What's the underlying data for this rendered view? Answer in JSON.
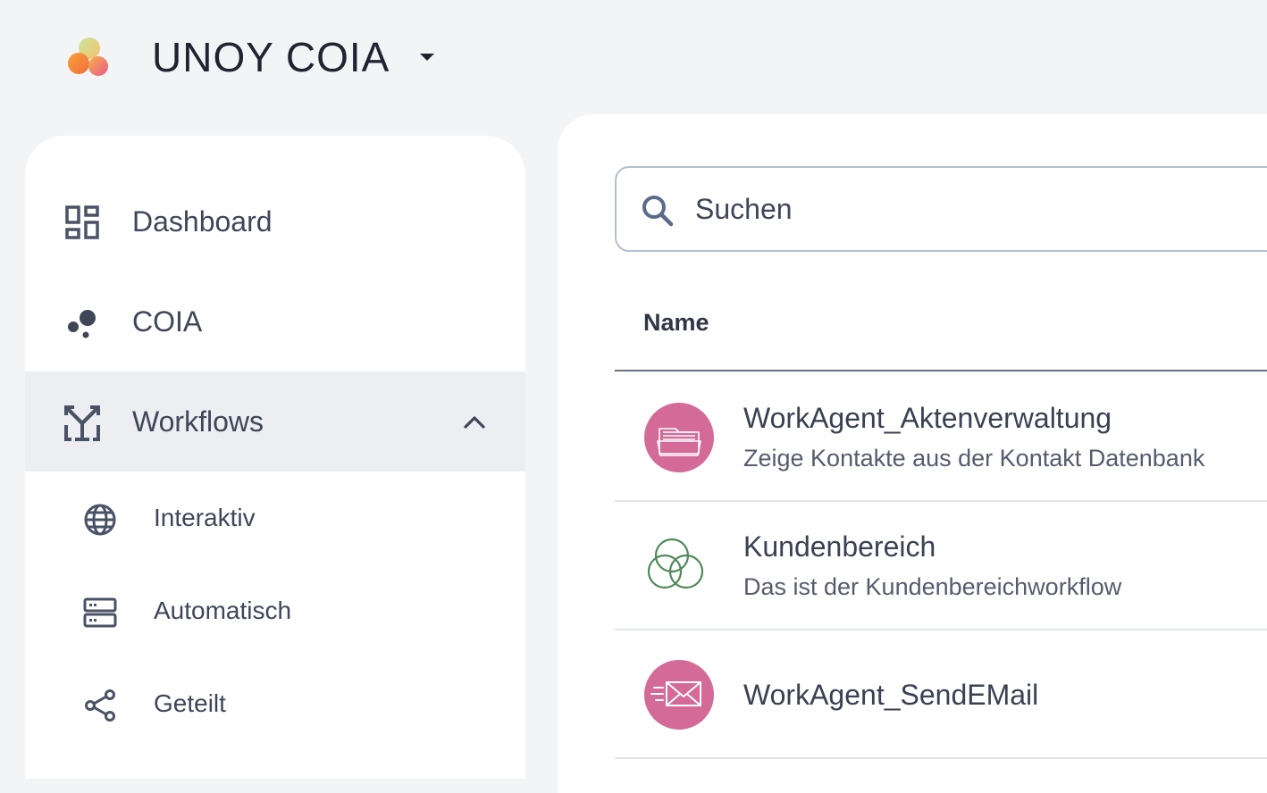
{
  "app": {
    "title": "UNOY COIA"
  },
  "sidebar": {
    "items": [
      {
        "label": "Dashboard",
        "icon": "dashboard-icon"
      },
      {
        "label": "COIA",
        "icon": "coia-icon"
      },
      {
        "label": "Workflows",
        "icon": "workflows-icon",
        "expanded": true
      }
    ],
    "sub_items": [
      {
        "label": "Interaktiv",
        "icon": "globe-icon"
      },
      {
        "label": "Automatisch",
        "icon": "server-icon"
      },
      {
        "label": "Geteilt",
        "icon": "share-icon"
      }
    ]
  },
  "search": {
    "placeholder": "Suchen",
    "value": ""
  },
  "table": {
    "column_name": "Name",
    "rows": [
      {
        "title": "WorkAgent_Aktenverwaltung",
        "subtitle": "Zeige Kontakte aus der Kontakt Datenbank",
        "icon": "folder-icon"
      },
      {
        "title": "Kundenbereich",
        "subtitle": "Das ist der Kundenbereichworkflow",
        "icon": "circles-icon"
      },
      {
        "title": "WorkAgent_SendEMail",
        "subtitle": "",
        "icon": "mail-icon"
      }
    ]
  },
  "colors": {
    "background": "#f3f4f6",
    "active_nav": "#eceef2",
    "avatar_pink": "#d46a98",
    "circles_green": "#4f8a5a",
    "icon_gray": "#4a5266"
  }
}
